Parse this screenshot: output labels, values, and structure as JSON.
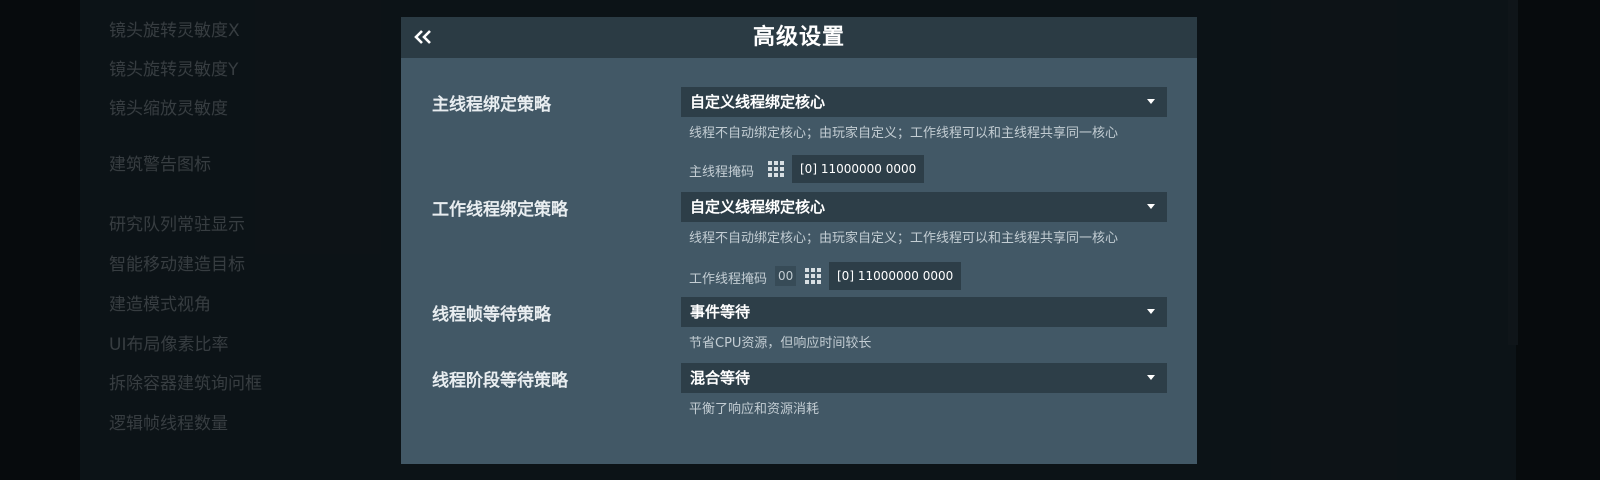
{
  "background": {
    "settings_list": [
      "镜头旋转灵敏度X",
      "镜头旋转灵敏度Y",
      "镜头缩放灵敏度",
      "建筑警告图标",
      "研究队列常驻显示",
      "智能移动建造目标",
      "建造模式视角",
      "UI布局像素比率",
      "拆除容器建筑询问框",
      "逻辑帧线程数量"
    ]
  },
  "dialog": {
    "title": "高级设置",
    "back_icon": "double-chevron-left-icon",
    "main_thread": {
      "label": "主线程绑定策略",
      "selected": "自定义线程绑定核心",
      "description": "线程不自动绑定核心；由玩家自定义；工作线程可以和主线程共享同一核心",
      "mask_label": "主线程掩码",
      "mask_value": "[0] 11000000 0000"
    },
    "worker_thread": {
      "label": "工作线程绑定策略",
      "selected": "自定义线程绑定核心",
      "description": "线程不自动绑定核心；由玩家自定义；工作线程可以和主线程共享同一核心",
      "mask_label": "工作线程掩码",
      "index_value": "00",
      "mask_value": "[0] 11000000 0000"
    },
    "frame_wait": {
      "label": "线程帧等待策略",
      "selected": "事件等待",
      "description": "节省CPU资源，但响应时间较长"
    },
    "stage_wait": {
      "label": "线程阶段等待策略",
      "selected": "混合等待",
      "description": "平衡了响应和资源消耗"
    }
  },
  "colors": {
    "dialog_bg": "#425866",
    "header_bg": "#2b3b44",
    "dropdown_bg": "#2d3e48"
  }
}
